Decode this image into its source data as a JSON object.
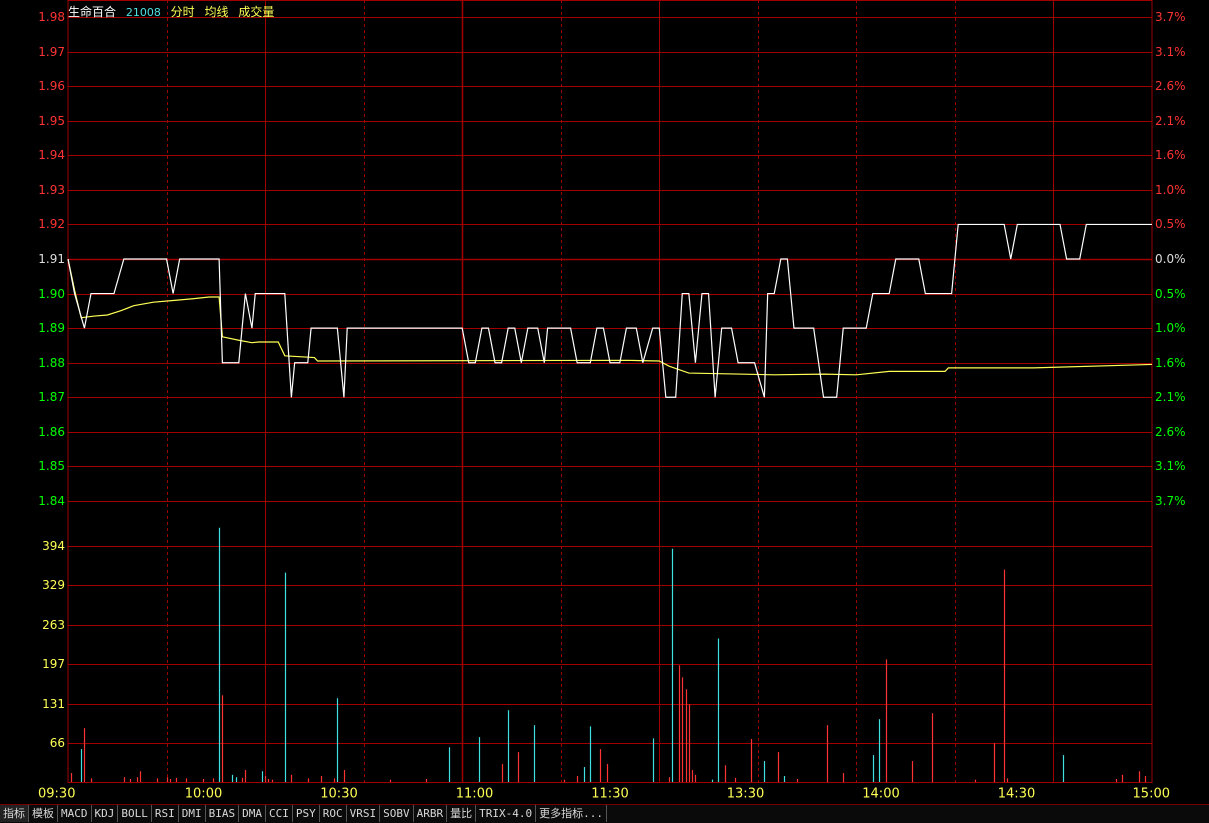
{
  "header": {
    "stock_name": "生命百合",
    "stock_code": "21008",
    "items": [
      "分时",
      "均线",
      "成交量"
    ]
  },
  "colors": {
    "background": "#000000",
    "grid": "#a00000",
    "price_line": "#ffffff",
    "avg_line": "#ffff55",
    "up": "#ff3333",
    "down": "#00ff00",
    "volume_up": "#ff3333",
    "volume_down": "#40e0e0",
    "volume_axis": "#ffff55"
  },
  "chart_data": {
    "type": "line",
    "title": "",
    "x_ticks": [
      "09:30",
      "10:00",
      "10:30",
      "11:00",
      "11:30",
      "13:30",
      "14:00",
      "14:30",
      "15:00"
    ],
    "price_ticks": [
      "1.98",
      "1.97",
      "1.96",
      "1.95",
      "1.94",
      "1.93",
      "1.92",
      "1.91",
      "1.90",
      "1.89",
      "1.88",
      "1.87",
      "1.86",
      "1.85",
      "1.84"
    ],
    "pct_ticks": [
      "3.7%",
      "3.1%",
      "2.6%",
      "2.1%",
      "1.6%",
      "1.0%",
      "0.5%",
      "0.0%",
      "0.5%",
      "1.0%",
      "1.6%",
      "2.1%",
      "2.6%",
      "3.1%",
      "3.7%"
    ],
    "prev_close": 1.91,
    "price_range": [
      1.84,
      1.98
    ],
    "volume_ticks": [
      "394",
      "329",
      "263",
      "197",
      "131",
      "66"
    ],
    "volume_range": [
      0,
      433
    ],
    "series": [
      {
        "key": "price",
        "points": [
          [
            0,
            1.91
          ],
          [
            2,
            1.9
          ],
          [
            5,
            1.89
          ],
          [
            7,
            1.9
          ],
          [
            14,
            1.9
          ],
          [
            17,
            1.91
          ],
          [
            30,
            1.91
          ],
          [
            32,
            1.9
          ],
          [
            34,
            1.91
          ],
          [
            46,
            1.91
          ],
          [
            47,
            1.88
          ],
          [
            52,
            1.88
          ],
          [
            54,
            1.9
          ],
          [
            56,
            1.89
          ],
          [
            57,
            1.9
          ],
          [
            66,
            1.9
          ],
          [
            68,
            1.87
          ],
          [
            69,
            1.88
          ],
          [
            73,
            1.88
          ],
          [
            74,
            1.89
          ],
          [
            82,
            1.89
          ],
          [
            84,
            1.87
          ],
          [
            85,
            1.89
          ],
          [
            120,
            1.89
          ],
          [
            122,
            1.88
          ],
          [
            124,
            1.88
          ],
          [
            126,
            1.89
          ],
          [
            128,
            1.89
          ],
          [
            130,
            1.88
          ],
          [
            132,
            1.88
          ],
          [
            134,
            1.89
          ],
          [
            136,
            1.89
          ],
          [
            138,
            1.88
          ],
          [
            140,
            1.89
          ],
          [
            143,
            1.89
          ],
          [
            145,
            1.88
          ],
          [
            146,
            1.89
          ],
          [
            153,
            1.89
          ],
          [
            155,
            1.88
          ],
          [
            159,
            1.88
          ],
          [
            161,
            1.89
          ],
          [
            163,
            1.89
          ],
          [
            165,
            1.88
          ],
          [
            168,
            1.88
          ],
          [
            170,
            1.89
          ],
          [
            173,
            1.89
          ],
          [
            175,
            1.88
          ],
          [
            178,
            1.89
          ],
          [
            180,
            1.89
          ],
          [
            182,
            1.87
          ],
          [
            185,
            1.87
          ],
          [
            187,
            1.9
          ],
          [
            189,
            1.9
          ],
          [
            191,
            1.88
          ],
          [
            192,
            1.89
          ],
          [
            193,
            1.9
          ],
          [
            195,
            1.9
          ],
          [
            197,
            1.87
          ],
          [
            199,
            1.89
          ],
          [
            202,
            1.89
          ],
          [
            204,
            1.88
          ],
          [
            209,
            1.88
          ],
          [
            212,
            1.87
          ],
          [
            213,
            1.9
          ],
          [
            215,
            1.9
          ],
          [
            217,
            1.91
          ],
          [
            219,
            1.91
          ],
          [
            221,
            1.89
          ],
          [
            227,
            1.89
          ],
          [
            230,
            1.87
          ],
          [
            234,
            1.87
          ],
          [
            236,
            1.89
          ],
          [
            243,
            1.89
          ],
          [
            245,
            1.9
          ],
          [
            250,
            1.9
          ],
          [
            252,
            1.91
          ],
          [
            259,
            1.91
          ],
          [
            261,
            1.9
          ],
          [
            269,
            1.9
          ],
          [
            271,
            1.92
          ],
          [
            285,
            1.92
          ],
          [
            287,
            1.91
          ],
          [
            289,
            1.92
          ],
          [
            302,
            1.92
          ],
          [
            304,
            1.91
          ],
          [
            308,
            1.91
          ],
          [
            310,
            1.92
          ],
          [
            330,
            1.92
          ]
        ]
      },
      {
        "key": "average",
        "points": [
          [
            0,
            1.91
          ],
          [
            2,
            1.901
          ],
          [
            4,
            1.893
          ],
          [
            8,
            1.8935
          ],
          [
            12,
            1.8938
          ],
          [
            16,
            1.895
          ],
          [
            20,
            1.8965
          ],
          [
            26,
            1.8975
          ],
          [
            32,
            1.898
          ],
          [
            38,
            1.8985
          ],
          [
            43,
            1.899
          ],
          [
            46,
            1.899
          ],
          [
            47,
            1.8875
          ],
          [
            52,
            1.8865
          ],
          [
            56,
            1.8858
          ],
          [
            58,
            1.886
          ],
          [
            64,
            1.886
          ],
          [
            66,
            1.882
          ],
          [
            75,
            1.8815
          ],
          [
            76,
            1.8805
          ],
          [
            170,
            1.8807
          ],
          [
            180,
            1.8805
          ],
          [
            183,
            1.879
          ],
          [
            189,
            1.877
          ],
          [
            215,
            1.8765
          ],
          [
            230,
            1.8767
          ],
          [
            240,
            1.8765
          ],
          [
            250,
            1.8775
          ],
          [
            267,
            1.8775
          ],
          [
            268,
            1.8785
          ],
          [
            294,
            1.8785
          ],
          [
            330,
            1.8795
          ]
        ]
      }
    ],
    "volume": [
      {
        "t": 1,
        "v": 15,
        "dir": "up"
      },
      {
        "t": 4,
        "v": 55,
        "dir": "down"
      },
      {
        "t": 5,
        "v": 90,
        "dir": "up"
      },
      {
        "t": 7,
        "v": 6,
        "dir": "up"
      },
      {
        "t": 17,
        "v": 8,
        "dir": "up"
      },
      {
        "t": 19,
        "v": 5,
        "dir": "up"
      },
      {
        "t": 21,
        "v": 8,
        "dir": "up"
      },
      {
        "t": 22,
        "v": 18,
        "dir": "up"
      },
      {
        "t": 27,
        "v": 6,
        "dir": "up"
      },
      {
        "t": 30,
        "v": 8,
        "dir": "up"
      },
      {
        "t": 31,
        "v": 5,
        "dir": "up"
      },
      {
        "t": 33,
        "v": 7,
        "dir": "up"
      },
      {
        "t": 36,
        "v": 6,
        "dir": "up"
      },
      {
        "t": 41,
        "v": 5,
        "dir": "up"
      },
      {
        "t": 44,
        "v": 6,
        "dir": "up"
      },
      {
        "t": 46,
        "v": 425,
        "dir": "down"
      },
      {
        "t": 47,
        "v": 145,
        "dir": "up"
      },
      {
        "t": 50,
        "v": 12,
        "dir": "down"
      },
      {
        "t": 51,
        "v": 8,
        "dir": "down"
      },
      {
        "t": 53,
        "v": 7,
        "dir": "up"
      },
      {
        "t": 54,
        "v": 20,
        "dir": "up"
      },
      {
        "t": 59,
        "v": 18,
        "dir": "down"
      },
      {
        "t": 60,
        "v": 10,
        "dir": "up"
      },
      {
        "t": 61,
        "v": 5,
        "dir": "up"
      },
      {
        "t": 62,
        "v": 4,
        "dir": "up"
      },
      {
        "t": 66,
        "v": 350,
        "dir": "down"
      },
      {
        "t": 68,
        "v": 12,
        "dir": "up"
      },
      {
        "t": 73,
        "v": 6,
        "dir": "up"
      },
      {
        "t": 77,
        "v": 10,
        "dir": "up"
      },
      {
        "t": 81,
        "v": 6,
        "dir": "up"
      },
      {
        "t": 82,
        "v": 140,
        "dir": "down"
      },
      {
        "t": 84,
        "v": 20,
        "dir": "up"
      },
      {
        "t": 98,
        "v": 4,
        "dir": "up"
      },
      {
        "t": 109,
        "v": 5,
        "dir": "up"
      },
      {
        "t": 116,
        "v": 58,
        "dir": "down"
      },
      {
        "t": 125,
        "v": 75,
        "dir": "down"
      },
      {
        "t": 132,
        "v": 30,
        "dir": "up"
      },
      {
        "t": 134,
        "v": 120,
        "dir": "down"
      },
      {
        "t": 137,
        "v": 50,
        "dir": "up"
      },
      {
        "t": 142,
        "v": 95,
        "dir": "down"
      },
      {
        "t": 151,
        "v": 4,
        "dir": "up"
      },
      {
        "t": 155,
        "v": 10,
        "dir": "up"
      },
      {
        "t": 157,
        "v": 25,
        "dir": "down"
      },
      {
        "t": 159,
        "v": 93,
        "dir": "down"
      },
      {
        "t": 162,
        "v": 55,
        "dir": "up"
      },
      {
        "t": 164,
        "v": 30,
        "dir": "up"
      },
      {
        "t": 178,
        "v": 73,
        "dir": "down"
      },
      {
        "t": 183,
        "v": 8,
        "dir": "up"
      },
      {
        "t": 184,
        "v": 390,
        "dir": "down"
      },
      {
        "t": 186,
        "v": 195,
        "dir": "up"
      },
      {
        "t": 187,
        "v": 175,
        "dir": "up"
      },
      {
        "t": 188,
        "v": 155,
        "dir": "up"
      },
      {
        "t": 189,
        "v": 130,
        "dir": "up"
      },
      {
        "t": 190,
        "v": 20,
        "dir": "up"
      },
      {
        "t": 191,
        "v": 12,
        "dir": "up"
      },
      {
        "t": 196,
        "v": 4,
        "dir": "down"
      },
      {
        "t": 198,
        "v": 240,
        "dir": "down"
      },
      {
        "t": 200,
        "v": 28,
        "dir": "up"
      },
      {
        "t": 203,
        "v": 7,
        "dir": "up"
      },
      {
        "t": 208,
        "v": 72,
        "dir": "up"
      },
      {
        "t": 212,
        "v": 35,
        "dir": "down"
      },
      {
        "t": 216,
        "v": 50,
        "dir": "up"
      },
      {
        "t": 218,
        "v": 10,
        "dir": "down"
      },
      {
        "t": 222,
        "v": 5,
        "dir": "up"
      },
      {
        "t": 231,
        "v": 95,
        "dir": "up"
      },
      {
        "t": 236,
        "v": 15,
        "dir": "up"
      },
      {
        "t": 245,
        "v": 45,
        "dir": "down"
      },
      {
        "t": 247,
        "v": 105,
        "dir": "down"
      },
      {
        "t": 249,
        "v": 205,
        "dir": "up"
      },
      {
        "t": 257,
        "v": 35,
        "dir": "up"
      },
      {
        "t": 263,
        "v": 115,
        "dir": "up"
      },
      {
        "t": 276,
        "v": 4,
        "dir": "up"
      },
      {
        "t": 282,
        "v": 65,
        "dir": "up"
      },
      {
        "t": 285,
        "v": 355,
        "dir": "up"
      },
      {
        "t": 286,
        "v": 6,
        "dir": "up"
      },
      {
        "t": 303,
        "v": 45,
        "dir": "down"
      },
      {
        "t": 319,
        "v": 5,
        "dir": "up"
      },
      {
        "t": 321,
        "v": 12,
        "dir": "up"
      },
      {
        "t": 326,
        "v": 18,
        "dir": "up"
      },
      {
        "t": 328,
        "v": 10,
        "dir": "up"
      }
    ]
  },
  "tabs": [
    "指标",
    "模板",
    "MACD",
    "KDJ",
    "BOLL",
    "RSI",
    "DMI",
    "BIAS",
    "DMA",
    "CCI",
    "PSY",
    "ROC",
    "VRSI",
    "SOBV",
    "ARBR",
    "量比",
    "TRIX-4.0",
    "更多指标..."
  ]
}
